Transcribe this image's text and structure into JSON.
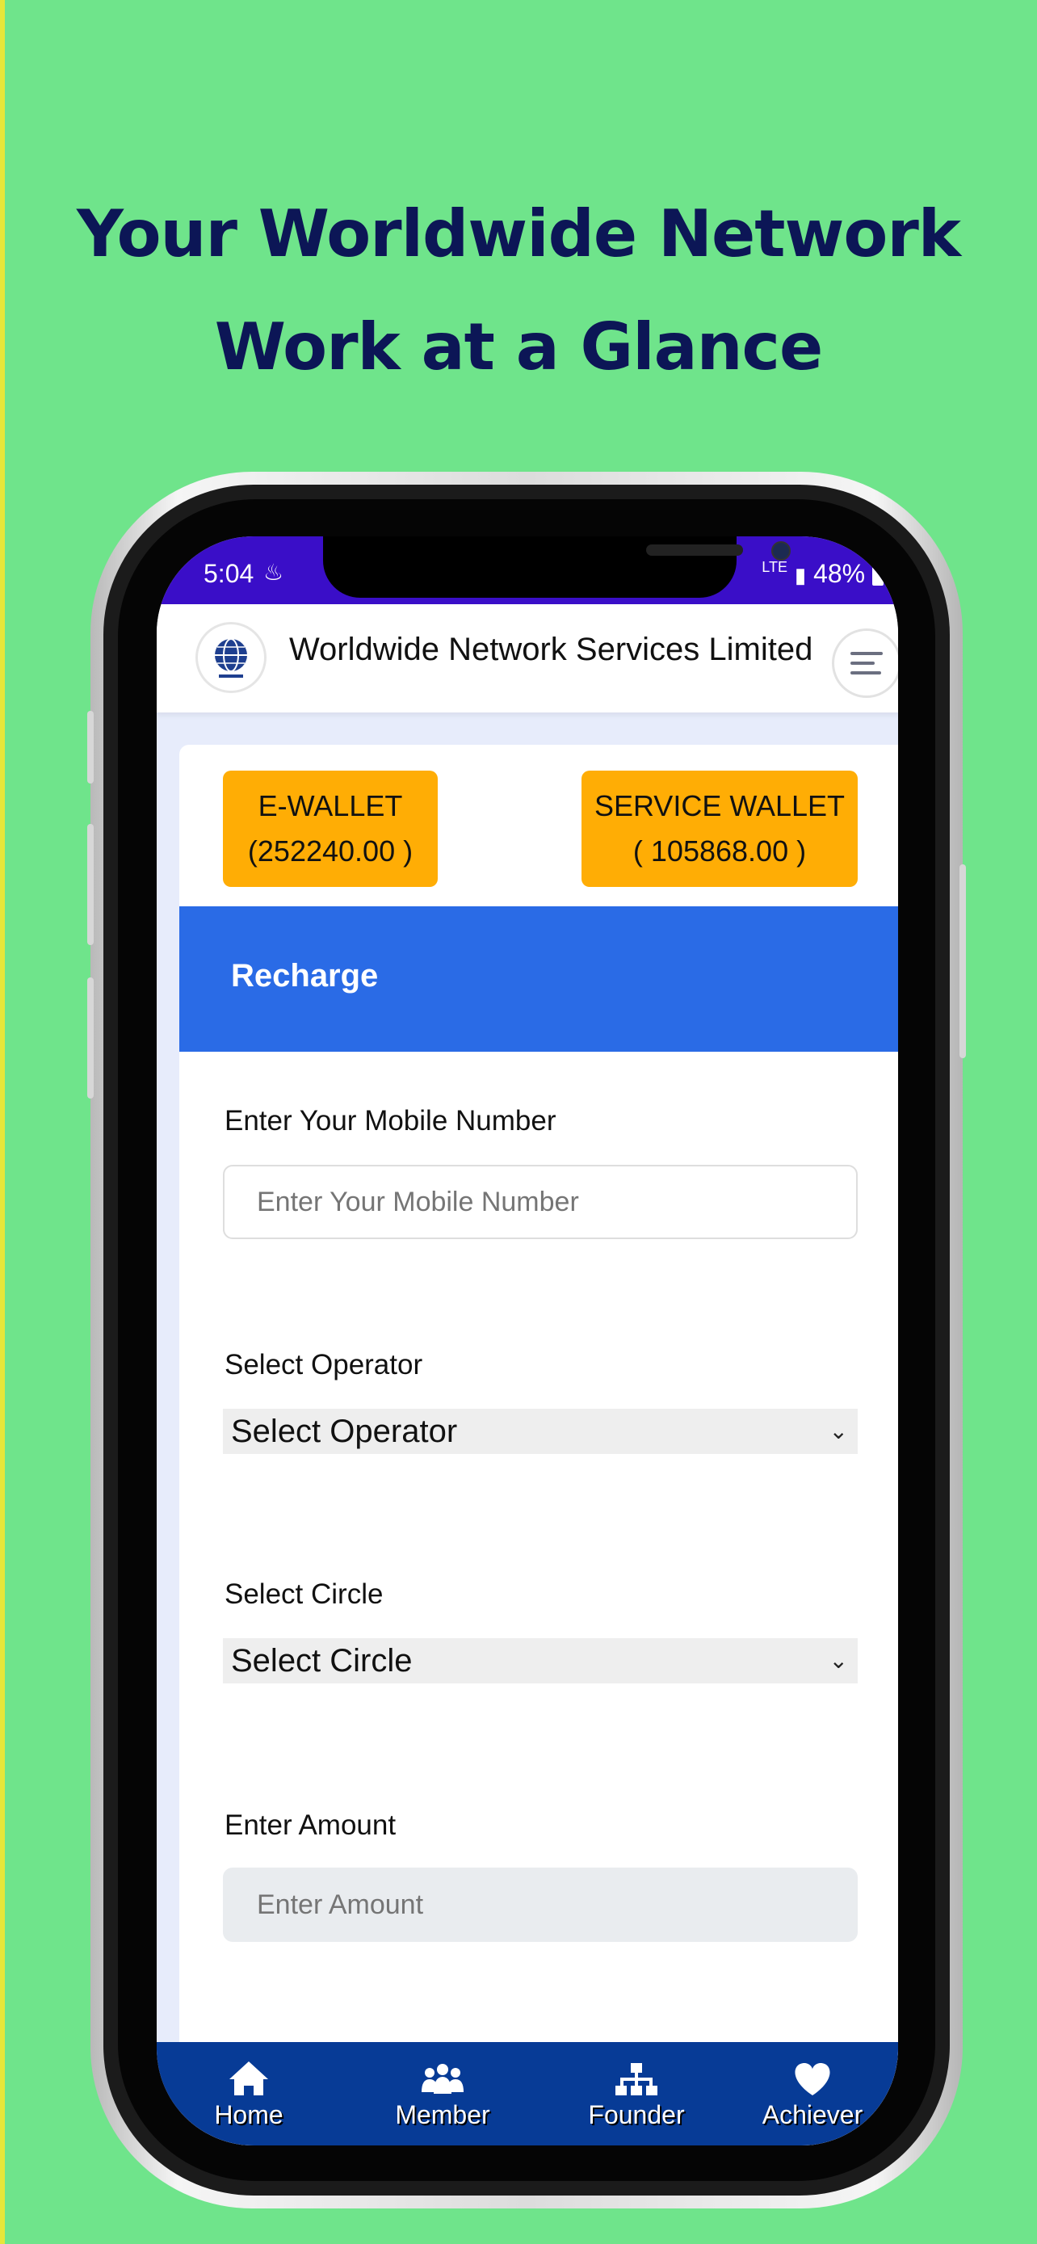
{
  "headline": {
    "line1": "Your Worldwide Network",
    "line2": "Work at a Glance"
  },
  "status": {
    "time": "5:04",
    "network": "LTE",
    "battery": "48%"
  },
  "app": {
    "title": "Worldwide Network Services Limited"
  },
  "wallets": {
    "ewallet_label": "E-WALLET",
    "ewallet_value": "(252240.00 )",
    "service_label": "SERVICE WALLET",
    "service_value": "( 105868.00 )"
  },
  "recharge": {
    "title": "Recharge",
    "mobile_label": "Enter Your Mobile Number",
    "mobile_placeholder": "Enter Your Mobile Number",
    "operator_label": "Select Operator",
    "operator_value": "Select Operator",
    "circle_label": "Select Circle",
    "circle_value": "Select Circle",
    "amount_label": "Enter Amount",
    "amount_placeholder": "Enter Amount"
  },
  "nav": [
    {
      "label": "Home",
      "icon": "home-icon"
    },
    {
      "label": "Member",
      "icon": "members-icon"
    },
    {
      "label": "Founder",
      "icon": "hierarchy-icon"
    },
    {
      "label": "Achiever",
      "icon": "heart-icon"
    }
  ],
  "colors": {
    "background": "#6fe48b",
    "accent": "#2a6be6",
    "wallet": "#ffad05",
    "nav": "#073b96",
    "headline": "#0c1656"
  }
}
